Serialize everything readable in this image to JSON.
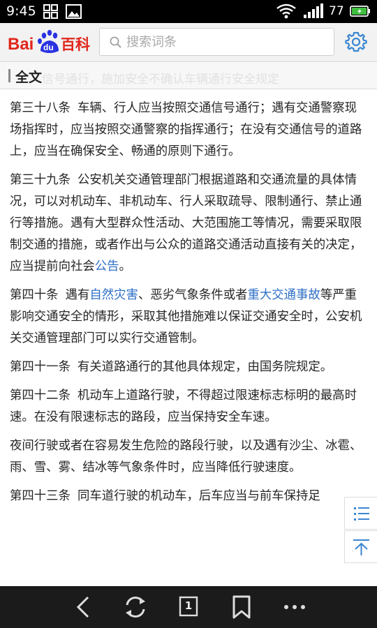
{
  "status_bar": {
    "time": "9:45",
    "battery": "77",
    "icons": [
      "grid-icon",
      "image-icon",
      "wifi-icon",
      "signal-icon",
      "battery-icon"
    ]
  },
  "header": {
    "logo_text_left": "Bai",
    "logo_text_paw": "du",
    "logo_text_right": "百科",
    "search_placeholder": "搜索词条",
    "colors": {
      "brand_red": "#e1251b",
      "brand_blue": "#2932e1",
      "accent": "#2e6fc6"
    }
  },
  "section": {
    "title": "全文",
    "ghost": "信号通行，施加安全不确认车辆通行安全规定"
  },
  "content": {
    "paragraphs": [
      {
        "num": "第三十八条",
        "segments": [
          {
            "text": "车辆、行人应当按照交通信号通行；遇有交通警察现场指挥时，应当按照交通警察的指挥通行；在没有交通信号的道路上，应当在确保安全、畅通的原则下通行。",
            "link": false
          }
        ]
      },
      {
        "num": "第三十九条",
        "segments": [
          {
            "text": "公安机关交通管理部门根据道路和交通流量的具体情况，可以对机动车、非机动车、行人采取疏导、限制通行、禁止通行等措施。遇有大型群众性活动、大范围施工等情况，需要采取限制交通的措施，或者作出与公众的道路交通活动直接有关的决定，应当提前向社会",
            "link": false
          },
          {
            "text": "公告",
            "link": true
          },
          {
            "text": "。",
            "link": false
          }
        ]
      },
      {
        "num": "第四十条",
        "segments": [
          {
            "text": "遇有",
            "link": false
          },
          {
            "text": "自然灾害",
            "link": true
          },
          {
            "text": "、恶劣气象条件或者",
            "link": false
          },
          {
            "text": "重大交通事故",
            "link": true
          },
          {
            "text": "等严重影响交通安全的情形，采取其他措施难以保证交通安全时，公安机关交通管理部门可以实行交通管制。",
            "link": false
          }
        ]
      },
      {
        "num": "第四十一条",
        "segments": [
          {
            "text": "有关道路通行的其他具体规定，由国务院规定。",
            "link": false
          }
        ]
      },
      {
        "num": "第四十二条",
        "segments": [
          {
            "text": "机动车上道路行驶，不得超过限速标志标明的最高时速。在没有限速标志的路段，应当保持安全车速。",
            "link": false
          }
        ]
      },
      {
        "num": "",
        "segments": [
          {
            "text": "夜间行驶或者在容易发生危险的路段行驶，以及遇有沙尘、冰雹、雨、雪、雾、结冰等气象条件时，应当降低行驶速度。",
            "link": false
          }
        ]
      },
      {
        "num": "第四十三条",
        "segments": [
          {
            "text": "同车道行驶的机动车，后车应当与前车保持足",
            "link": false
          }
        ]
      }
    ]
  },
  "floating": {
    "icons": [
      "list-icon",
      "back-to-top-icon"
    ]
  },
  "bottom_nav": {
    "tab_count": "1",
    "icons": [
      "back-arrow-icon",
      "refresh-icon",
      "tabs-icon",
      "bookmark-icon",
      "more-icon"
    ]
  }
}
